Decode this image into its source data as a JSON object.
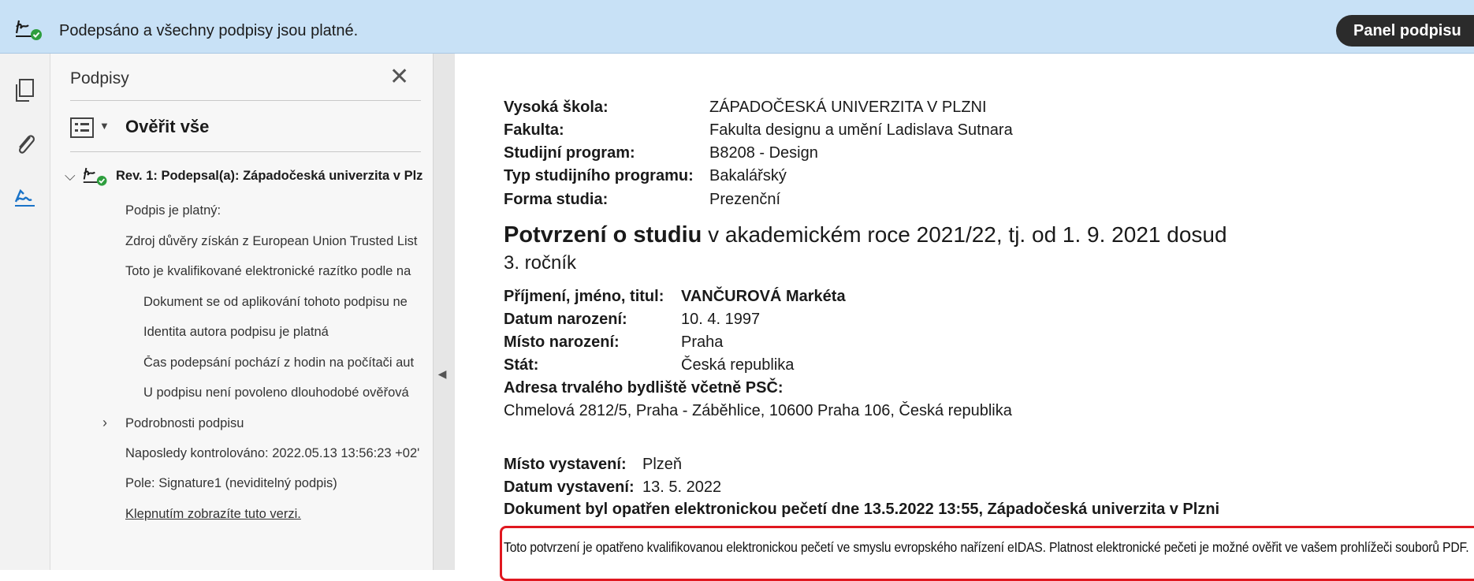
{
  "notification": {
    "message": "Podepsáno a všechny podpisy jsou platné.",
    "panel_button": "Panel podpisu"
  },
  "rail": {
    "icons": [
      "pages-icon",
      "attachments-icon",
      "signatures-icon"
    ]
  },
  "signatures_panel": {
    "title": "Podpisy",
    "verify_all": "Ověřit vše",
    "revision": "Rev. 1: Podepsal(a): Západočeská univerzita v Plz",
    "items": [
      {
        "text": "Podpis je platný:"
      },
      {
        "text": "Zdroj důvěry získán z European Union Trusted List"
      },
      {
        "text": "Toto je kvalifikované elektronické razítko podle na"
      },
      {
        "text": "Dokument se od aplikování tohoto podpisu ne"
      },
      {
        "text": "Identita autora podpisu je platná"
      },
      {
        "text": "Čas podepsání pochází z hodin na počítači aut"
      },
      {
        "text": "U podpisu není povoleno dlouhodobé ověřová"
      },
      {
        "text": "Podrobnosti podpisu"
      },
      {
        "text": "Naposledy kontrolováno: 2022.05.13 13:56:23 +02'"
      },
      {
        "text": "Pole: Signature1 (neviditelný podpis)"
      },
      {
        "text": "Klepnutím zobrazíte tuto verzi."
      }
    ]
  },
  "document": {
    "info": [
      {
        "label": "Vysoká škola:",
        "value": "ZÁPADOČESKÁ UNIVERZITA V PLZNI"
      },
      {
        "label": "Fakulta:",
        "value": "Fakulta designu a umění Ladislava Sutnara"
      },
      {
        "label": "Studijní program:",
        "value": "B8208 - Design"
      },
      {
        "label": "Typ studijního programu:",
        "value": "Bakalářský"
      },
      {
        "label": "Forma studia:",
        "value": "Prezenční"
      }
    ],
    "heading_bold": "Potvrzení o studiu",
    "heading_rest": " v akademickém roce 2021/22, tj. od 1. 9. 2021 dosud",
    "year": "3. ročník",
    "person": [
      {
        "label": "Příjmení, jméno, titul:",
        "value": "VANČUROVÁ Markéta"
      },
      {
        "label": "Datum narození:",
        "value": "10. 4. 1997"
      },
      {
        "label": "Místo narození:",
        "value": "Praha"
      },
      {
        "label": "Stát:",
        "value": "Česká republika"
      }
    ],
    "address_label": "Adresa trvalého bydliště včetně PSČ:",
    "address_value": "Chmelová 2812/5, Praha - Záběhlice, 10600 Praha 106, Česká republika",
    "issue": [
      {
        "label": "Místo vystavení:",
        "value": "Plzeň"
      },
      {
        "label": "Datum vystavení:",
        "value": "13. 5. 2022"
      }
    ],
    "seal_line": "Dokument byl opatřen elektronickou pečetí dne 13.5.2022 13:55, Západočeská univerzita v Plzni",
    "stamp_text": "Toto potvrzení je opatřeno kvalifikovanou elektronickou pečetí ve smyslu evropského nařízení eIDAS. Platnost elektronické pečeti je možné ověřit ve vašem prohlížeči souborů PDF."
  },
  "colors": {
    "notification_bg": "#c8e1f6",
    "valid_green": "#2e9e3e",
    "stamp_border": "#e0171f",
    "panel_button_bg": "#2b2b2b"
  }
}
